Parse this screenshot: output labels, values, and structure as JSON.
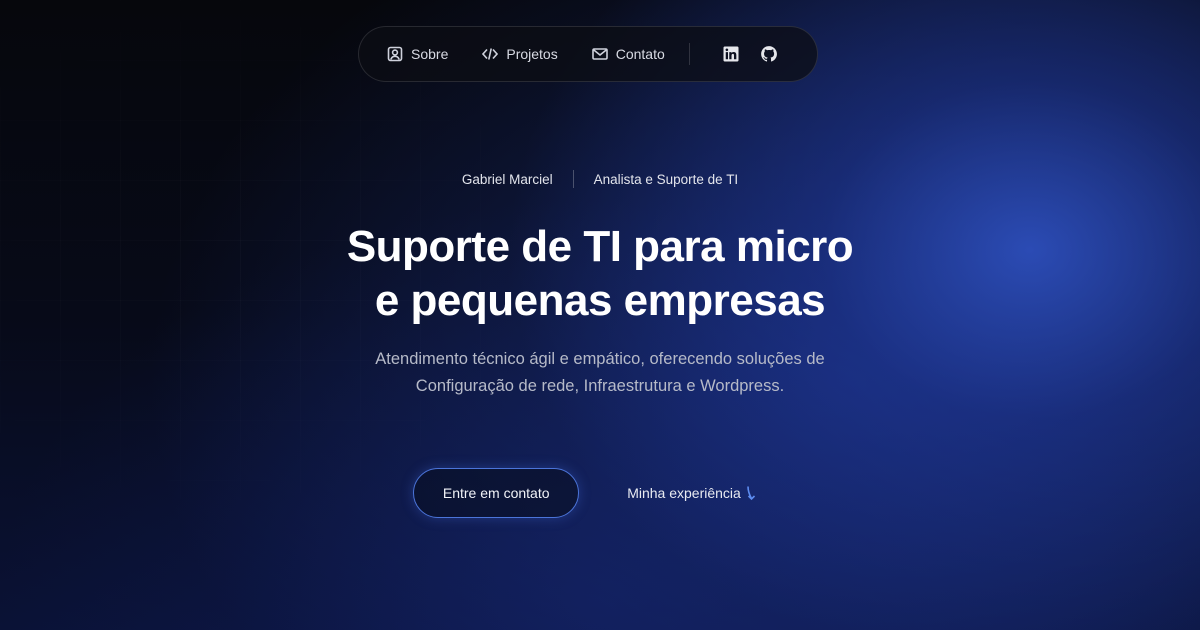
{
  "nav": {
    "items": [
      {
        "label": "Sobre",
        "icon": "user-icon"
      },
      {
        "label": "Projetos",
        "icon": "code-icon"
      },
      {
        "label": "Contato",
        "icon": "mail-icon"
      }
    ],
    "social": [
      {
        "icon": "linkedin-icon"
      },
      {
        "icon": "github-icon"
      }
    ]
  },
  "byline": {
    "name": "Gabriel Marciel",
    "role": "Analista e Suporte de TI"
  },
  "hero": {
    "headline_line1": "Suporte de TI para micro",
    "headline_line2": "e pequenas empresas",
    "subtitle_line1": "Atendimento técnico ágil e empático, oferecendo soluções de",
    "subtitle_line2": "Configuração de rede, Infraestrutura e Wordpress."
  },
  "cta": {
    "primary_label": "Entre em contato",
    "secondary_label": "Minha experiência",
    "secondary_icon": "arrow-down-icon"
  },
  "colors": {
    "accent": "#4b74d9",
    "arrow": "#5d8cf0",
    "background": "#06070c"
  }
}
